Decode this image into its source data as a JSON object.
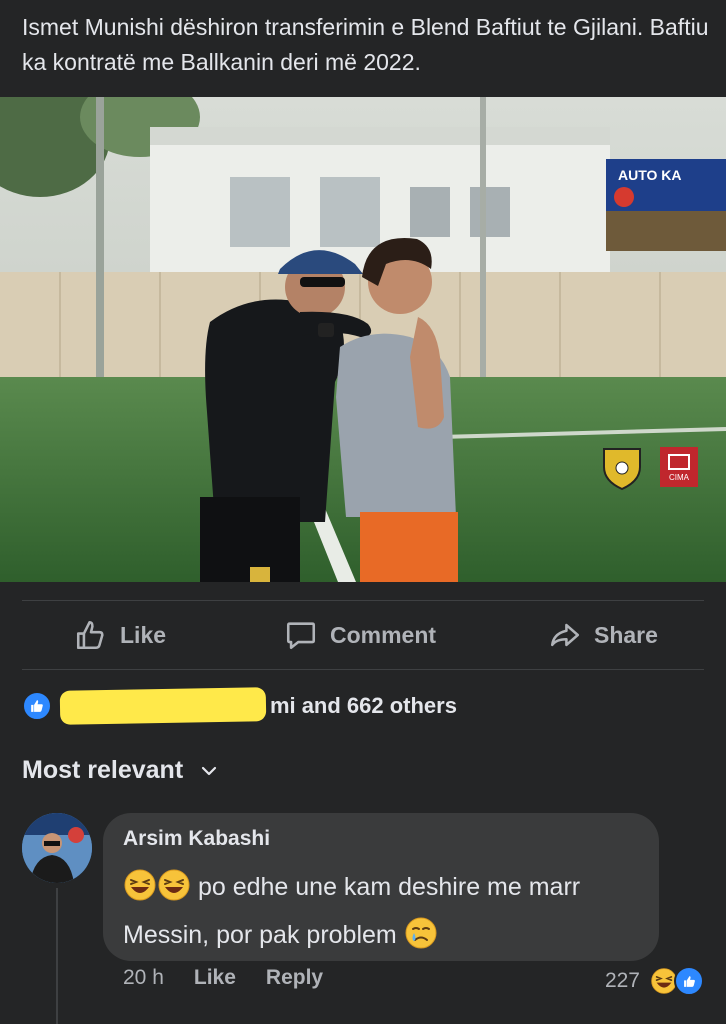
{
  "post": {
    "caption": "Ismet Munishi dëshiron transferimin e Blend Baftiut te Gjilani. Baftiu ka kontratë me Ballkanin deri më 2022."
  },
  "photo": {
    "sign_text": "AUTO KA",
    "watermark": "CIMA"
  },
  "actions": {
    "like_label": "Like",
    "comment_label": "Comment",
    "share_label": "Share"
  },
  "reactions": {
    "partial_name": "mi",
    "summary": "and 662 others"
  },
  "comments_sort": {
    "label": "Most relevant"
  },
  "comment": {
    "author": "Arsim Kabashi",
    "text_line1": "po edhe une kam deshire me marr",
    "text_line2": "Messin, por pak problem",
    "time": "20 h",
    "like_label": "Like",
    "reply_label": "Reply",
    "reaction_count": "227"
  },
  "colors": {
    "background": "#242526",
    "bubble": "#3a3b3c",
    "text_primary": "#e4e6eb",
    "text_secondary": "#b0b3b8",
    "like_blue": "#2d88ff",
    "redaction_yellow": "#ffe94a"
  },
  "icons": [
    "like-icon",
    "comment-icon",
    "share-icon",
    "chevron-down-icon",
    "laughing-emoji-icon",
    "crying-emoji-icon"
  ]
}
